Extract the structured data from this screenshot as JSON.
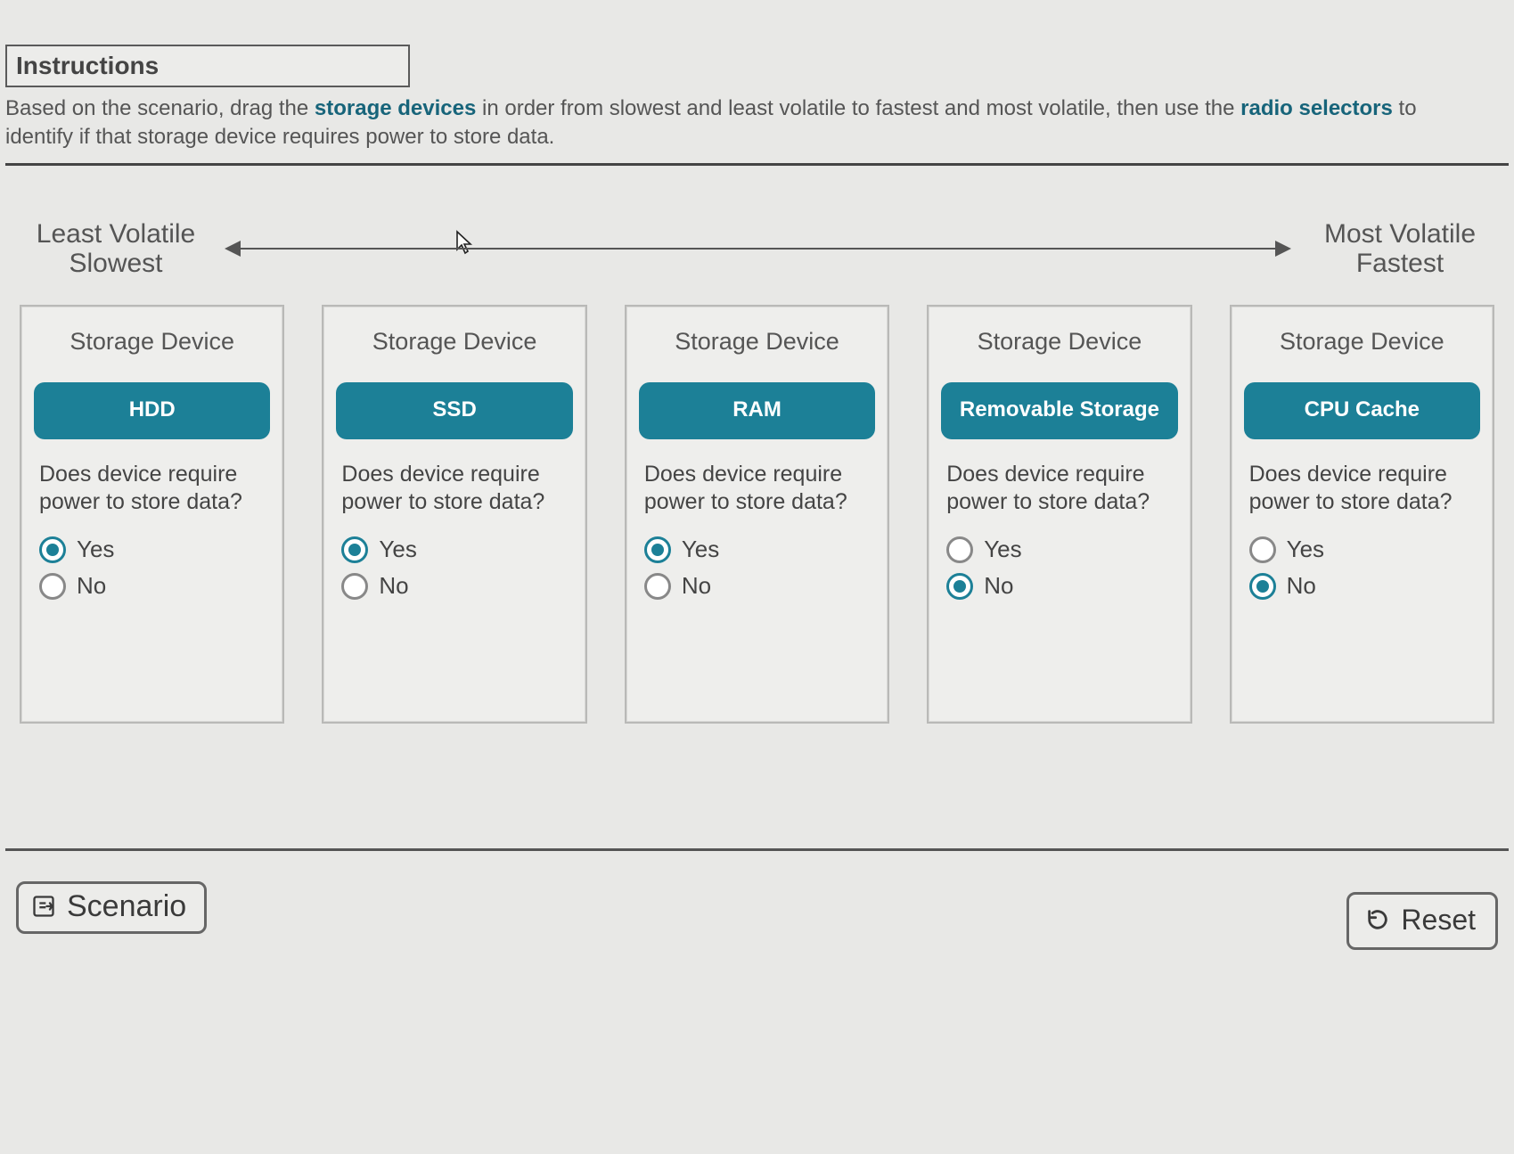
{
  "instructions": {
    "title": "Instructions",
    "prefix": "Based on the scenario, drag the ",
    "highlight1": "storage devices",
    "middle": " in order from slowest and least volatile to fastest and most volatile, then use the ",
    "highlight2": "radio selectors",
    "suffix": " to identify if that storage device requires power to store data."
  },
  "arrow": {
    "left_line1": "Least Volatile",
    "left_line2": "Slowest",
    "right_line1": "Most Volatile",
    "right_line2": "Fastest"
  },
  "card_header": "Storage Device",
  "question": "Does device require power to store data?",
  "options": {
    "yes": "Yes",
    "no": "No"
  },
  "cards": [
    {
      "device": "HDD",
      "selected": "yes"
    },
    {
      "device": "SSD",
      "selected": "yes"
    },
    {
      "device": "RAM",
      "selected": "yes"
    },
    {
      "device": "Removable Storage",
      "selected": "no"
    },
    {
      "device": "CPU Cache",
      "selected": "no"
    }
  ],
  "footer": {
    "scenario": "Scenario",
    "reset": "Reset"
  }
}
